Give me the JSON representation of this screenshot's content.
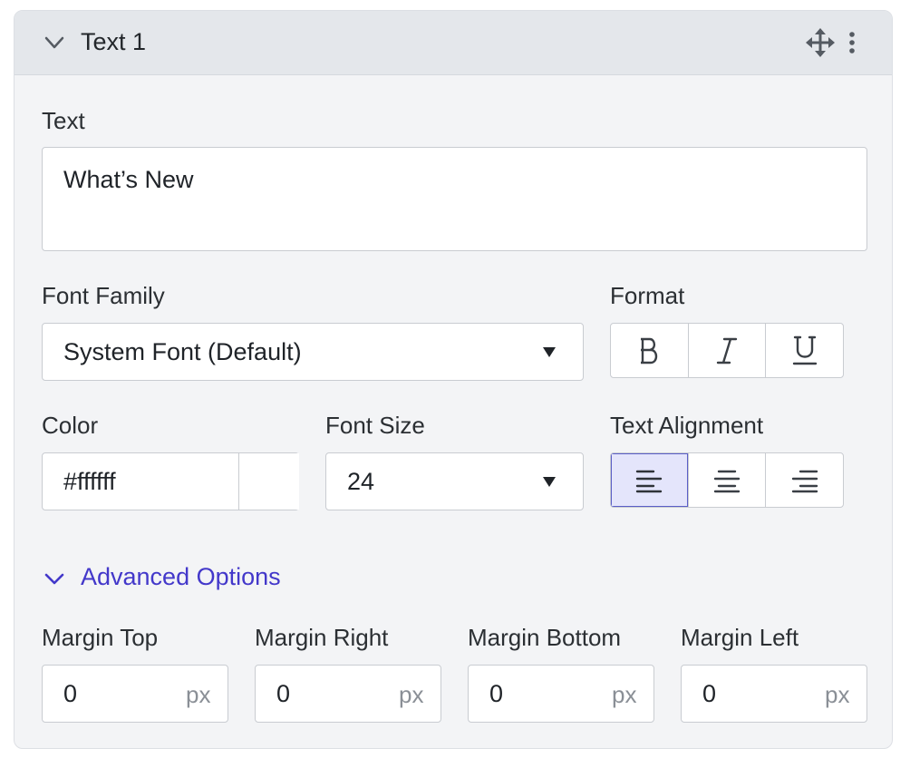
{
  "panel": {
    "title": "Text 1",
    "icons": {
      "collapse": "chevron-down-icon",
      "move": "move-icon",
      "more": "kebab-icon"
    }
  },
  "text_field": {
    "label": "Text",
    "value": "What’s New"
  },
  "font_family": {
    "label": "Font Family",
    "value": "System Font (Default)"
  },
  "format": {
    "label": "Format",
    "buttons": [
      {
        "name": "bold",
        "glyph": "B"
      },
      {
        "name": "italic",
        "glyph": "I"
      },
      {
        "name": "underline",
        "glyph": "U"
      }
    ]
  },
  "color": {
    "label": "Color",
    "value": "#ffffff",
    "swatch": "#ffffff"
  },
  "font_size": {
    "label": "Font Size",
    "value": "24"
  },
  "alignment": {
    "label": "Text Alignment",
    "options": [
      "left",
      "center",
      "right"
    ],
    "selected": "left"
  },
  "advanced": {
    "label": "Advanced Options",
    "margins": [
      {
        "label": "Margin Top",
        "value": "0",
        "unit": "px"
      },
      {
        "label": "Margin Right",
        "value": "0",
        "unit": "px"
      },
      {
        "label": "Margin Bottom",
        "value": "0",
        "unit": "px"
      },
      {
        "label": "Margin Left",
        "value": "0",
        "unit": "px"
      }
    ]
  },
  "colors": {
    "accent": "#4338ca",
    "active_bg": "#e4e5fb",
    "panel_bg": "#f3f4f6",
    "header_bg": "#e4e7eb"
  }
}
